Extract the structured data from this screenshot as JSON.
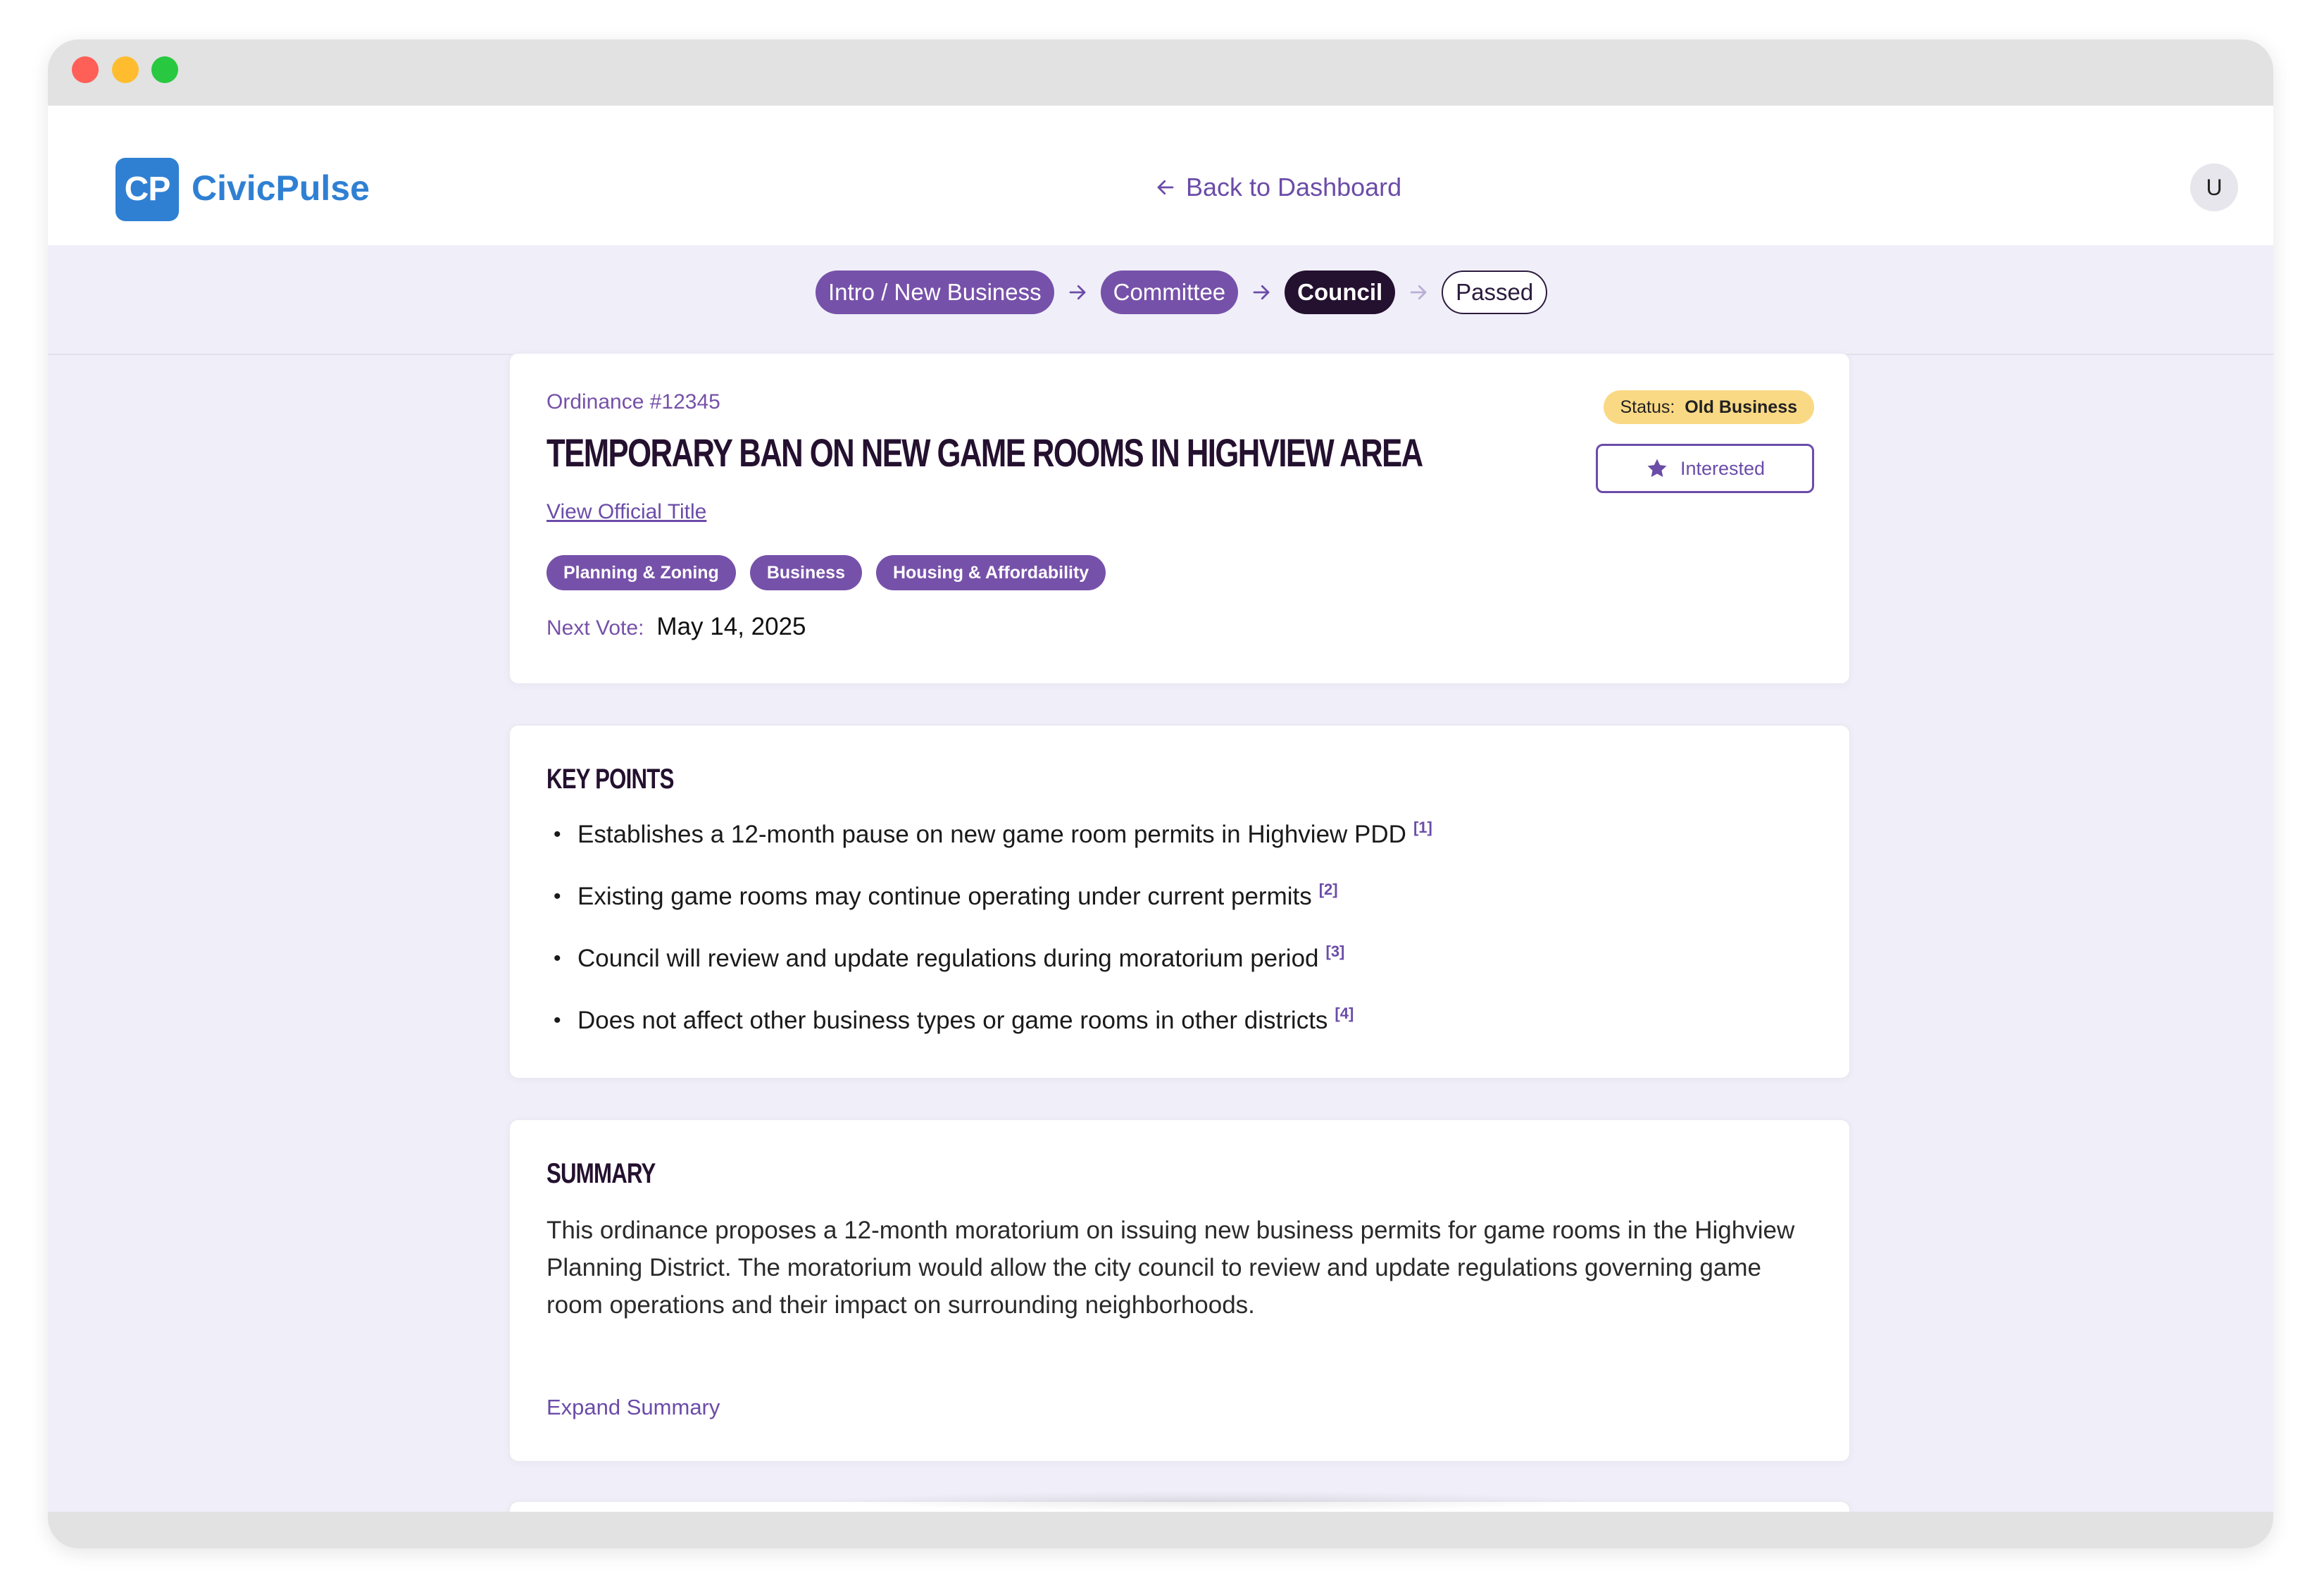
{
  "app": {
    "logo_initials": "CP",
    "name": "CivicPulse",
    "back_link": "Back to Dashboard",
    "user_initial": "U"
  },
  "stepper": [
    {
      "label": "Intro / New Business",
      "state": "done"
    },
    {
      "label": "Committee",
      "state": "done"
    },
    {
      "label": "Council",
      "state": "current"
    },
    {
      "label": "Passed",
      "state": "future"
    }
  ],
  "ordinance": {
    "number": "Ordinance #12345",
    "title": "Temporary Ban on New Game Rooms in Highview Area",
    "view_official_title": "View Official Title",
    "tags": [
      "Planning & Zoning",
      "Business",
      "Housing & Affordability"
    ],
    "next_vote_label": "Next Vote:",
    "next_vote_date": "May 14, 2025",
    "status_label": "Status:",
    "status_value": "Old Business",
    "interested_label": "Interested"
  },
  "key_points": {
    "title": "Key Points",
    "items": [
      {
        "text": "Establishes a 12-month pause on new game room permits in Highview PDD",
        "ref": "[1]"
      },
      {
        "text": "Existing game rooms may continue operating under current permits",
        "ref": "[2]"
      },
      {
        "text": "Council will review and update regulations during moratorium period",
        "ref": "[3]"
      },
      {
        "text": "Does not affect other business types or game rooms in other districts",
        "ref": "[4]"
      }
    ]
  },
  "summary": {
    "title": "Summary",
    "text": "This ordinance proposes a 12-month moratorium on issuing new business permits for game rooms in the Highview Planning District. The moratorium would allow the city council to review and update regulations governing game room operations and their impact on surrounding neighborhoods.",
    "expand_label": "Expand Summary"
  },
  "colors": {
    "brand_blue": "#2f80d3",
    "accent_purple": "#7651a9",
    "dark_purple": "#24102f",
    "status_yellow": "#fad985",
    "page_bg": "#f0eff9"
  }
}
